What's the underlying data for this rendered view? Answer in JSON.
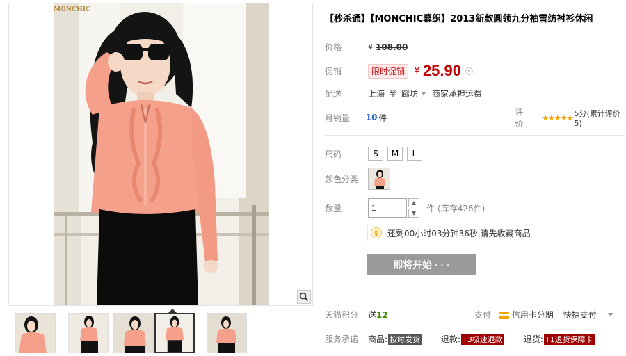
{
  "gallery": {
    "watermark": "MONCHIC",
    "thumbnails": [
      "thumb-1",
      "thumb-2",
      "thumb-3",
      "thumb-4",
      "thumb-5"
    ],
    "active_thumb": 4
  },
  "product": {
    "title": "【秒杀通】【MONCHIC慕织】2013新款圆领九分袖雪纺衬衫休闲",
    "price_label": "价格",
    "currency": "¥",
    "original_price": "108.00",
    "promo_label": "促销",
    "promo_badge": "限时促销",
    "promo_price": "25.90",
    "shipping_label": "配送",
    "ship_from": "上海",
    "ship_to_word": "至",
    "ship_to": "廊坊",
    "shipping_fee": "商家承担运费",
    "monthly_sales_label": "月销量",
    "monthly_sales_value": "10",
    "monthly_sales_unit": "件",
    "rating_label": "评价",
    "rating_stars": "★★★★★",
    "rating_text": "5分(累计评价5)",
    "size_label": "尺码",
    "sizes": [
      "S",
      "M",
      "L"
    ],
    "color_label": "颜色分类",
    "qty_label": "数量",
    "qty_value": "1",
    "qty_unit": "件",
    "stock_text": "(库存426件)",
    "countdown_text": "还剩00小时03分钟36秒,请先收藏商品",
    "buy_button": "即将开始 · · ·",
    "points_label": "天猫积分",
    "points_prefix": "送",
    "points_value": "12",
    "payment_label": "支付",
    "payment_credit": "信用卡分期",
    "payment_quick": "快捷支付",
    "service_label": "服务承诺",
    "service_1_prefix": "商品:",
    "service_1_tag": "按时发货",
    "service_2_prefix": "退款:",
    "service_2_tag": "T3极速退款",
    "service_3_prefix": "退货:",
    "service_3_tag": "T1退货保障卡"
  },
  "colors": {
    "price_red": "#c40000",
    "button_gray": "#9a9a9a",
    "blouse_coral": "#f4a08a",
    "accent_blue": "#3366cc"
  }
}
